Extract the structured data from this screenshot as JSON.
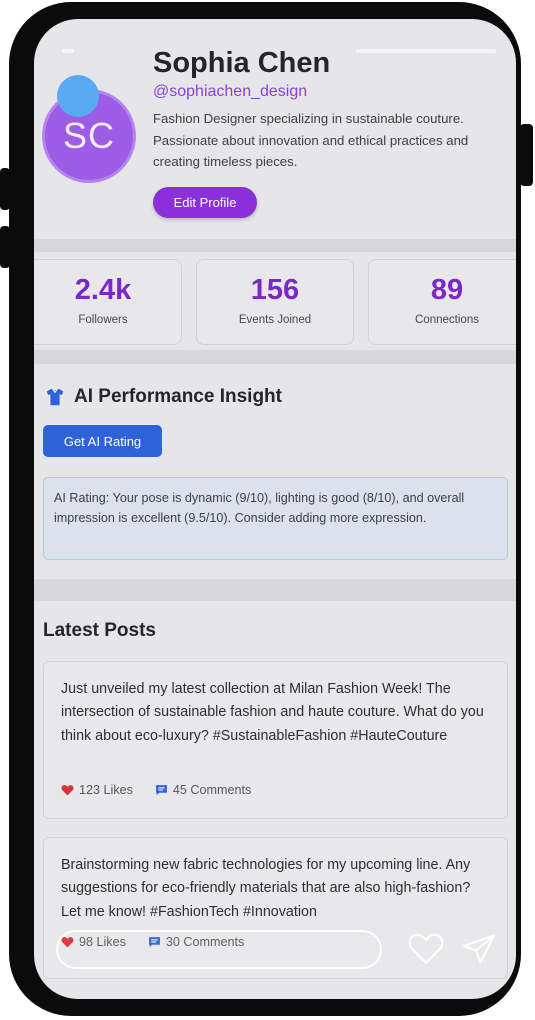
{
  "profile": {
    "initials": "SC",
    "name": "Sophia Chen",
    "handle": "@sophiachen_design",
    "bio": "Fashion Designer specializing in sustainable couture. Passionate about innovation and ethical practices and creating timeless pieces.",
    "edit_label": "Edit Profile"
  },
  "stats": [
    {
      "value": "2.4k",
      "label": "Followers"
    },
    {
      "value": "156",
      "label": "Events Joined"
    },
    {
      "value": "89",
      "label": "Connections"
    }
  ],
  "ai": {
    "icon": "shirt-icon",
    "title": "AI Performance Insight",
    "button_label": "Get AI Rating",
    "result": "AI Rating: Your pose is dynamic (9/10), lighting is good (8/10), and overall impression is excellent (9.5/10). Consider adding more expression."
  },
  "posts": {
    "title": "Latest Posts",
    "items": [
      {
        "text": "Just unveiled my latest collection at Milan Fashion Week! The intersection of sustainable fashion and haute couture. What do you think about eco-luxury? #SustainableFashion #HauteCouture",
        "likes": "123 Likes",
        "comments": "45 Comments"
      },
      {
        "text": "Brainstorming new fabric technologies for my upcoming line. Any suggestions for eco-friendly materials that are also high-fashion? Let me know! #FashionTech #Innovation",
        "likes": "98 Likes",
        "comments": "30 Comments"
      }
    ]
  },
  "colors": {
    "accent_purple": "#8a2fd9",
    "accent_blue": "#2d62d8",
    "like_red": "#d8333b"
  }
}
